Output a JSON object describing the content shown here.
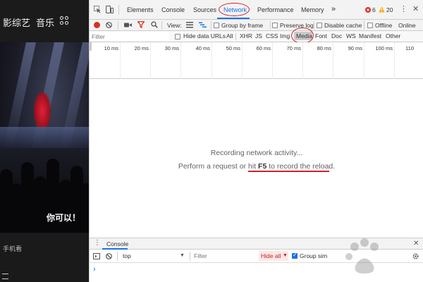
{
  "site": {
    "nav_items": [
      "影",
      "综艺",
      "音乐"
    ],
    "video_caption": "你可以！",
    "mobile_link": "手机看"
  },
  "devtools": {
    "tabs": [
      "Elements",
      "Console",
      "Sources",
      "Network",
      "Performance",
      "Memory"
    ],
    "more_tabs": "»",
    "error_count": "6",
    "warning_count": "20",
    "toolbar": {
      "view_label": "View:",
      "group_by_frame": "Group by frame",
      "preserve_log": "Preserve log",
      "disable_cache": "Disable cache",
      "offline": "Offline",
      "throttle": "Online"
    },
    "filter": {
      "placeholder": "Filter",
      "hide_data_urls": "Hide data URLs",
      "types": [
        "All",
        "XHR",
        "JS",
        "CSS",
        "Img",
        "Media",
        "Font",
        "Doc",
        "WS",
        "Manifest",
        "Other"
      ]
    },
    "timeline_ticks": [
      "10 ms",
      "20 ms",
      "30 ms",
      "40 ms",
      "50 ms",
      "60 ms",
      "70 ms",
      "80 ms",
      "90 ms",
      "100 ms",
      "110"
    ],
    "empty_state": {
      "line1": "Recording network activity...",
      "line2_prefix": "Perform a request or hit ",
      "line2_key": "F5",
      "line2_suffix": " to record the reload."
    },
    "drawer": {
      "tab": "Console",
      "context": "top",
      "filter_placeholder": "Filter",
      "levels": "Hide all",
      "group_similar": "Group sim",
      "prompt": "›"
    }
  },
  "colors": {
    "accent": "#1a73e8",
    "highlight_red": "#d4222b",
    "error": "#d93025",
    "warning": "#f9ab00"
  }
}
